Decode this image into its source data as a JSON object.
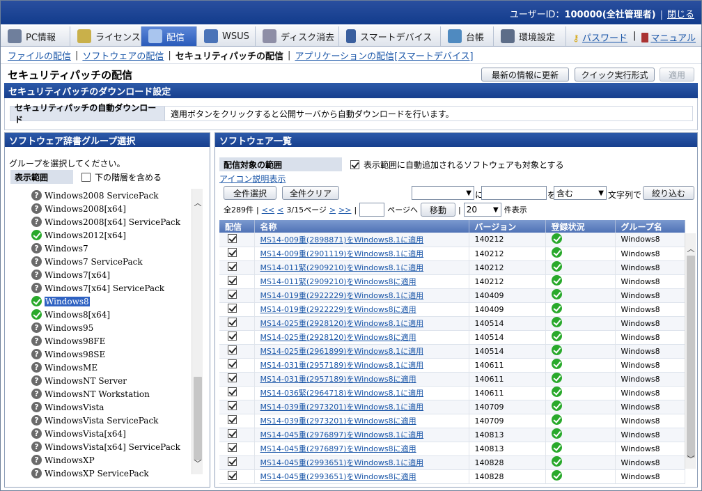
{
  "header": {
    "user_label": "ユーザーID：",
    "user_id": "100000(全社管理者)",
    "logout": "閉じる"
  },
  "tabs": [
    {
      "label": "PC情報",
      "icon": "pc-icon"
    },
    {
      "label": "ライセンス",
      "icon": "license-icon"
    },
    {
      "label": "配信",
      "icon": "delivery-icon",
      "active": true
    },
    {
      "label": "WSUS",
      "icon": "wsus-icon"
    },
    {
      "label": "ディスク消去",
      "icon": "disk-erase-icon"
    },
    {
      "label": "スマートデバイス",
      "icon": "smartphone-icon"
    },
    {
      "label": "台帳",
      "icon": "ledger-icon"
    },
    {
      "label": "環境設定",
      "icon": "tools-icon"
    }
  ],
  "nav_links": {
    "password": "パスワード",
    "manual": "マニュアル"
  },
  "subnav": {
    "file": "ファイルの配信",
    "software": "ソフトウェアの配信",
    "patch": "セキュリティパッチの配信",
    "app": "アプリケーションの配信[スマートデバイス]"
  },
  "page": {
    "title": "セキュリティパッチの配信",
    "refresh_btn": "最新の情報に更新",
    "quick_btn": "クイック実行形式",
    "apply_btn": "適用"
  },
  "download": {
    "header": "セキュリティパッチのダウンロード設定",
    "label": "セキュリティパッチの自動ダウンロード",
    "value": "適用ボタンをクリックすると公開サーバから自動ダウンロードを行います。"
  },
  "groups": {
    "header": "ソフトウェア辞書グループ選択",
    "note": "グループを選択してください。",
    "range_label": "表示範囲",
    "include_lower": "下の階層を含める",
    "selected": "Windows8",
    "items": [
      {
        "name": "Windows2008 ServicePack",
        "status": "unknown"
      },
      {
        "name": "Windows2008[x64]",
        "status": "unknown"
      },
      {
        "name": "Windows2008[x64] ServicePack",
        "status": "unknown"
      },
      {
        "name": "Windows2012[x64]",
        "status": "ok"
      },
      {
        "name": "Windows7",
        "status": "unknown"
      },
      {
        "name": "Windows7 ServicePack",
        "status": "unknown"
      },
      {
        "name": "Windows7[x64]",
        "status": "unknown"
      },
      {
        "name": "Windows7[x64] ServicePack",
        "status": "unknown"
      },
      {
        "name": "Windows8",
        "status": "ok"
      },
      {
        "name": "Windows8[x64]",
        "status": "ok"
      },
      {
        "name": "Windows95",
        "status": "unknown"
      },
      {
        "name": "Windows98FE",
        "status": "unknown"
      },
      {
        "name": "Windows98SE",
        "status": "unknown"
      },
      {
        "name": "WindowsME",
        "status": "unknown"
      },
      {
        "name": "WindowsNT Server",
        "status": "unknown"
      },
      {
        "name": "WindowsNT Workstation",
        "status": "unknown"
      },
      {
        "name": "WindowsVista",
        "status": "unknown"
      },
      {
        "name": "WindowsVista ServicePack",
        "status": "unknown"
      },
      {
        "name": "WindowsVista[x64]",
        "status": "unknown"
      },
      {
        "name": "WindowsVista[x64] ServicePack",
        "status": "unknown"
      },
      {
        "name": "WindowsXP",
        "status": "unknown"
      },
      {
        "name": "WindowsXP ServicePack",
        "status": "unknown"
      }
    ]
  },
  "software": {
    "header": "ソフトウェア一覧",
    "scope_label": "配信対象の範囲",
    "scope_value": "表示範囲に自動追加されるソフトウェアも対象とする",
    "icon_legend": "アイコン説明表示",
    "select_all": "全件選択",
    "clear_all": "全件クリア",
    "filter": {
      "field": "",
      "ni": "に",
      "text": "",
      "wo": "を",
      "mode": "含む",
      "suffix": "文字列で",
      "button": "絞り込む"
    },
    "pager": {
      "total": "全289件",
      "first": "<<",
      "prev": "<",
      "page": "3/15ページ",
      "next": ">",
      "last": ">>",
      "goto_suffix": "ページへ",
      "goto_btn": "移動",
      "per_page": "20",
      "per_page_suffix": "件表示"
    },
    "columns": [
      "配信",
      "名称",
      "バージョン",
      "登録状況",
      "グループ名"
    ],
    "rows": [
      {
        "name": "MS14-009重(2898871)をWindows8.1に適用",
        "version": "140212",
        "group": "Windows8"
      },
      {
        "name": "MS14-009重(2901119)をWindows8.1に適用",
        "version": "140212",
        "group": "Windows8"
      },
      {
        "name": "MS14-011緊(2909210)をWindows8.1に適用",
        "version": "140212",
        "group": "Windows8"
      },
      {
        "name": "MS14-011緊(2909210)をWindows8に適用",
        "version": "140212",
        "group": "Windows8"
      },
      {
        "name": "MS14-019重(2922229)をWindows8.1に適用",
        "version": "140409",
        "group": "Windows8"
      },
      {
        "name": "MS14-019重(2922229)をWindows8に適用",
        "version": "140409",
        "group": "Windows8"
      },
      {
        "name": "MS14-025重(2928120)をWindows8.1に適用",
        "version": "140514",
        "group": "Windows8"
      },
      {
        "name": "MS14-025重(2928120)をWindows8に適用",
        "version": "140514",
        "group": "Windows8"
      },
      {
        "name": "MS14-025重(2961899)をWindows8.1に適用",
        "version": "140514",
        "group": "Windows8"
      },
      {
        "name": "MS14-031重(2957189)をWindows8.1に適用",
        "version": "140611",
        "group": "Windows8"
      },
      {
        "name": "MS14-031重(2957189)をWindows8に適用",
        "version": "140611",
        "group": "Windows8"
      },
      {
        "name": "MS14-036緊(2964718)をWindows8.1に適用",
        "version": "140611",
        "group": "Windows8"
      },
      {
        "name": "MS14-039重(2973201)をWindows8.1に適用",
        "version": "140709",
        "group": "Windows8"
      },
      {
        "name": "MS14-039重(2973201)をWindows8に適用",
        "version": "140709",
        "group": "Windows8"
      },
      {
        "name": "MS14-045重(2976897)をWindows8.1に適用",
        "version": "140813",
        "group": "Windows8"
      },
      {
        "name": "MS14-045重(2976897)をWindows8に適用",
        "version": "140813",
        "group": "Windows8"
      },
      {
        "name": "MS14-045重(2993651)をWindows8.1に適用",
        "version": "140828",
        "group": "Windows8"
      },
      {
        "name": "MS14-045重(2993651)をWindows8に適用",
        "version": "140828",
        "group": "Windows8"
      }
    ]
  }
}
